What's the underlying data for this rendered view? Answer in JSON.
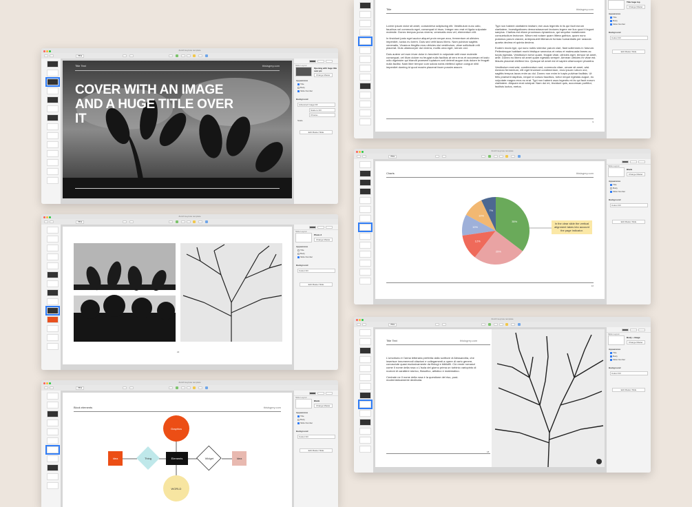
{
  "app": {
    "window_title": "Zurich keynote template",
    "zoom": "75%"
  },
  "inspector": {
    "slide_layout_label": "Slide Layout",
    "change_master": "Change Master",
    "appearance": "Appearance",
    "title": "Title",
    "body": "Body",
    "slide_number": "Slide Number",
    "background": "Background",
    "colour_fill": "Colour Fill",
    "advanced_image_fill": "Advanced Image Fill",
    "scale_to_fill": "Scale to Fill",
    "choose": "Choose...",
    "scale": "Scale",
    "edit_master": "Edit Master Slide"
  },
  "windows": {
    "cover": {
      "layout_name": "Opening with huge title over pic",
      "header_left": "Title Text",
      "header_right": "thisisgrey.com",
      "heading": "COVER WITH AN IMAGE AND A HUGE TITLE OVER IT"
    },
    "photo": {
      "layout_name": "Photo 3",
      "page": "22"
    },
    "blocks": {
      "layout_name": "Blank",
      "header_left": "Block elements",
      "header_right": "thisisgrey.com",
      "nodes": {
        "idea_left": "Idea",
        "thing": "Thing",
        "elements": "Elements",
        "widget": "Widget",
        "idea_right": "Idea",
        "graphics": "Graphics",
        "world": "WORLD"
      }
    },
    "text": {
      "layout_name": "Title huge top",
      "header_left": "Title",
      "header_right": "thisisgrey.com",
      "page": "9",
      "col1": [
        "Lorem ipsum dolor sit amet, consectetur adipiscing elit. Vestibulum nunc odio, faucibus vel commodo eget, consequat id risus. Integer nec erat et ligula vulputate molestie. Donec tempus purus viverra, venenatis eros vel, elementum elit.",
        "In tincidunt justo eget auctor aliquet proin neque arcu, fermentum at ultricies imperdiet, luctus eu lorem. Duis sed velit lacus libero. Nam pulvinar sagittis venenatis. Vivamus fringilla eros ultricies nisi vestibulum, vitae sollicitudin elit placerat. Duis ullamcorper dui viverra, mollis urna eget, rutrum orci.",
        "Duis autem vel eum iriure dolor in hendrerit in vulputate velit esse molestie consequat, vel illum dolore eu feugiat nulla facilisis at vero eros et accumsan et iusto odio dignissim qui blandit praesent luptatum zzril delenit augue duis dolore te feugait nulla facilisi. Nam liber tempor cum soluta nobis eleifend option congue nihil imperdiet doming id quod mazim placerat facer possim assum."
      ],
      "col2": [
        "Typi non habent claritatem insitam; est usus legentis in iis qui facit eorum claritatem. Investigationes demonstraverunt lectores legere me lius quod ii legunt saepius. Claritas est etiam processus dynamicus, qui sequitur mutationem consuetudium lectorum. Mirum est notare quam littera gothica, quam nunc putamus parum claram, anteposuerit litterarum formas humanitatis per seacula quarta decima et quinta decima.",
        "Eodem modo typi, qui nunc nobis videntur parum clari, fiant sollemnes in futurum. Pellentesque habitant morbi tristique senectus et netus et malesuada fames ac turpis egestas. Vestibulum tortor quam, feugiat vitae, ultricies eget, tempor sit amet, ante. Donec eu libero sit amet quam egestas semper. Aenean ultricies mi vitae est. Mauris placerat eleifend leo. Quisque sit amet est et sapien ullamcorper pharetra.",
        "Vestibulum erat wisi, condimentum sed, commodo vitae, ornare sit amet, wisi. Aenean fermentum, elit eget tincidunt condimentum, eros ipsum rutrum orci, sagittis tempus lacus enim ac dui. Donec non enim in turpis pulvinar facilisis. Ut felis praesent dapibus, neque id cursus faucibus, tortor neque egestas augue, eu vulputate magna eros eu erat. Typi non habent usus legentis mi iis qui facit eorum claritatem. Aliquam erat volutpat. Nam dui mi, tincidunt quis, accumsan porttitor, facilisis luctus, metus."
      ]
    },
    "chart": {
      "layout_name": "Blank",
      "header_left": "Charts",
      "header_right": "thisisgrey.com",
      "page": "12",
      "callout": "In the clear slide the vertical alignment takes into account the page indicator."
    },
    "body_image": {
      "layout_name": "Body + image",
      "header_left": "Title Text",
      "header_right": "thisisgrey.com",
      "page": "18",
      "para1": "L'umorismo è l'arma letteraria preferita dallo scrittore di Alessandria, che inserisce innumerevoli citazioni e collegamenti a opere di vario genere, conosciute quasi esclusivamente da filologi e bibliofili. Ciò rende romanzi come Il nome della rosa o L'isola del giorno prima un turbinio variopinto di nozioni di carattere storico, filosofico, artistico e matematico.",
      "para2": "Centrale ne Il nome della rosa è la questione del riso, post-modernisticamente declinata."
    }
  },
  "chart_data": {
    "type": "pie",
    "values": [
      35,
      25,
      12,
      10,
      10,
      7
    ],
    "labels": [
      "35%",
      "25%",
      "12%",
      "10%",
      "10%",
      "7%"
    ],
    "colors": [
      "#6aaa5a",
      "#e9a3a3",
      "#ef6a5a",
      "#9eb0d9",
      "#f2b872",
      "#4d6891"
    ]
  }
}
